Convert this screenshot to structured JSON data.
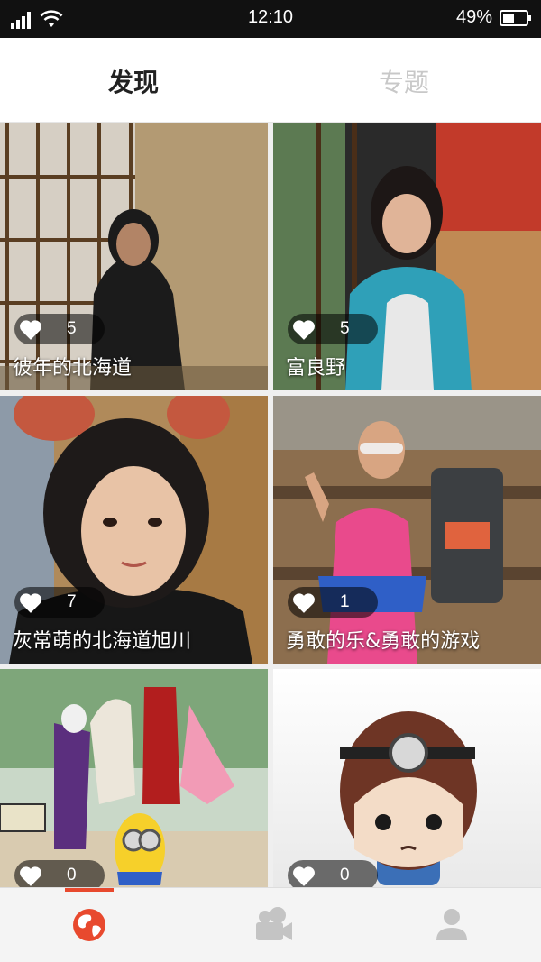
{
  "status_bar": {
    "time": "12:10",
    "battery_percent": "49%",
    "battery_level": 0.49
  },
  "tabs": [
    {
      "label": "发现",
      "active": true
    },
    {
      "label": "专题",
      "active": false
    }
  ],
  "cards": [
    {
      "title": "彼年的北海道",
      "likes": "5"
    },
    {
      "title": "富良野",
      "likes": "5"
    },
    {
      "title": "灰常萌的北海道旭川",
      "likes": "7"
    },
    {
      "title": "勇敢的乐&勇敢的游戏",
      "likes": "1"
    },
    {
      "title": "",
      "likes": "0"
    },
    {
      "title": "",
      "likes": "0"
    }
  ],
  "bottom_nav": {
    "items": [
      "globe-icon",
      "video-camera-icon",
      "person-icon"
    ],
    "active_index": 0
  },
  "colors": {
    "accent": "#e8492e",
    "tab_active": "#222222",
    "tab_inactive": "#c8c8c8",
    "nav_inactive": "#c4c4c4"
  }
}
